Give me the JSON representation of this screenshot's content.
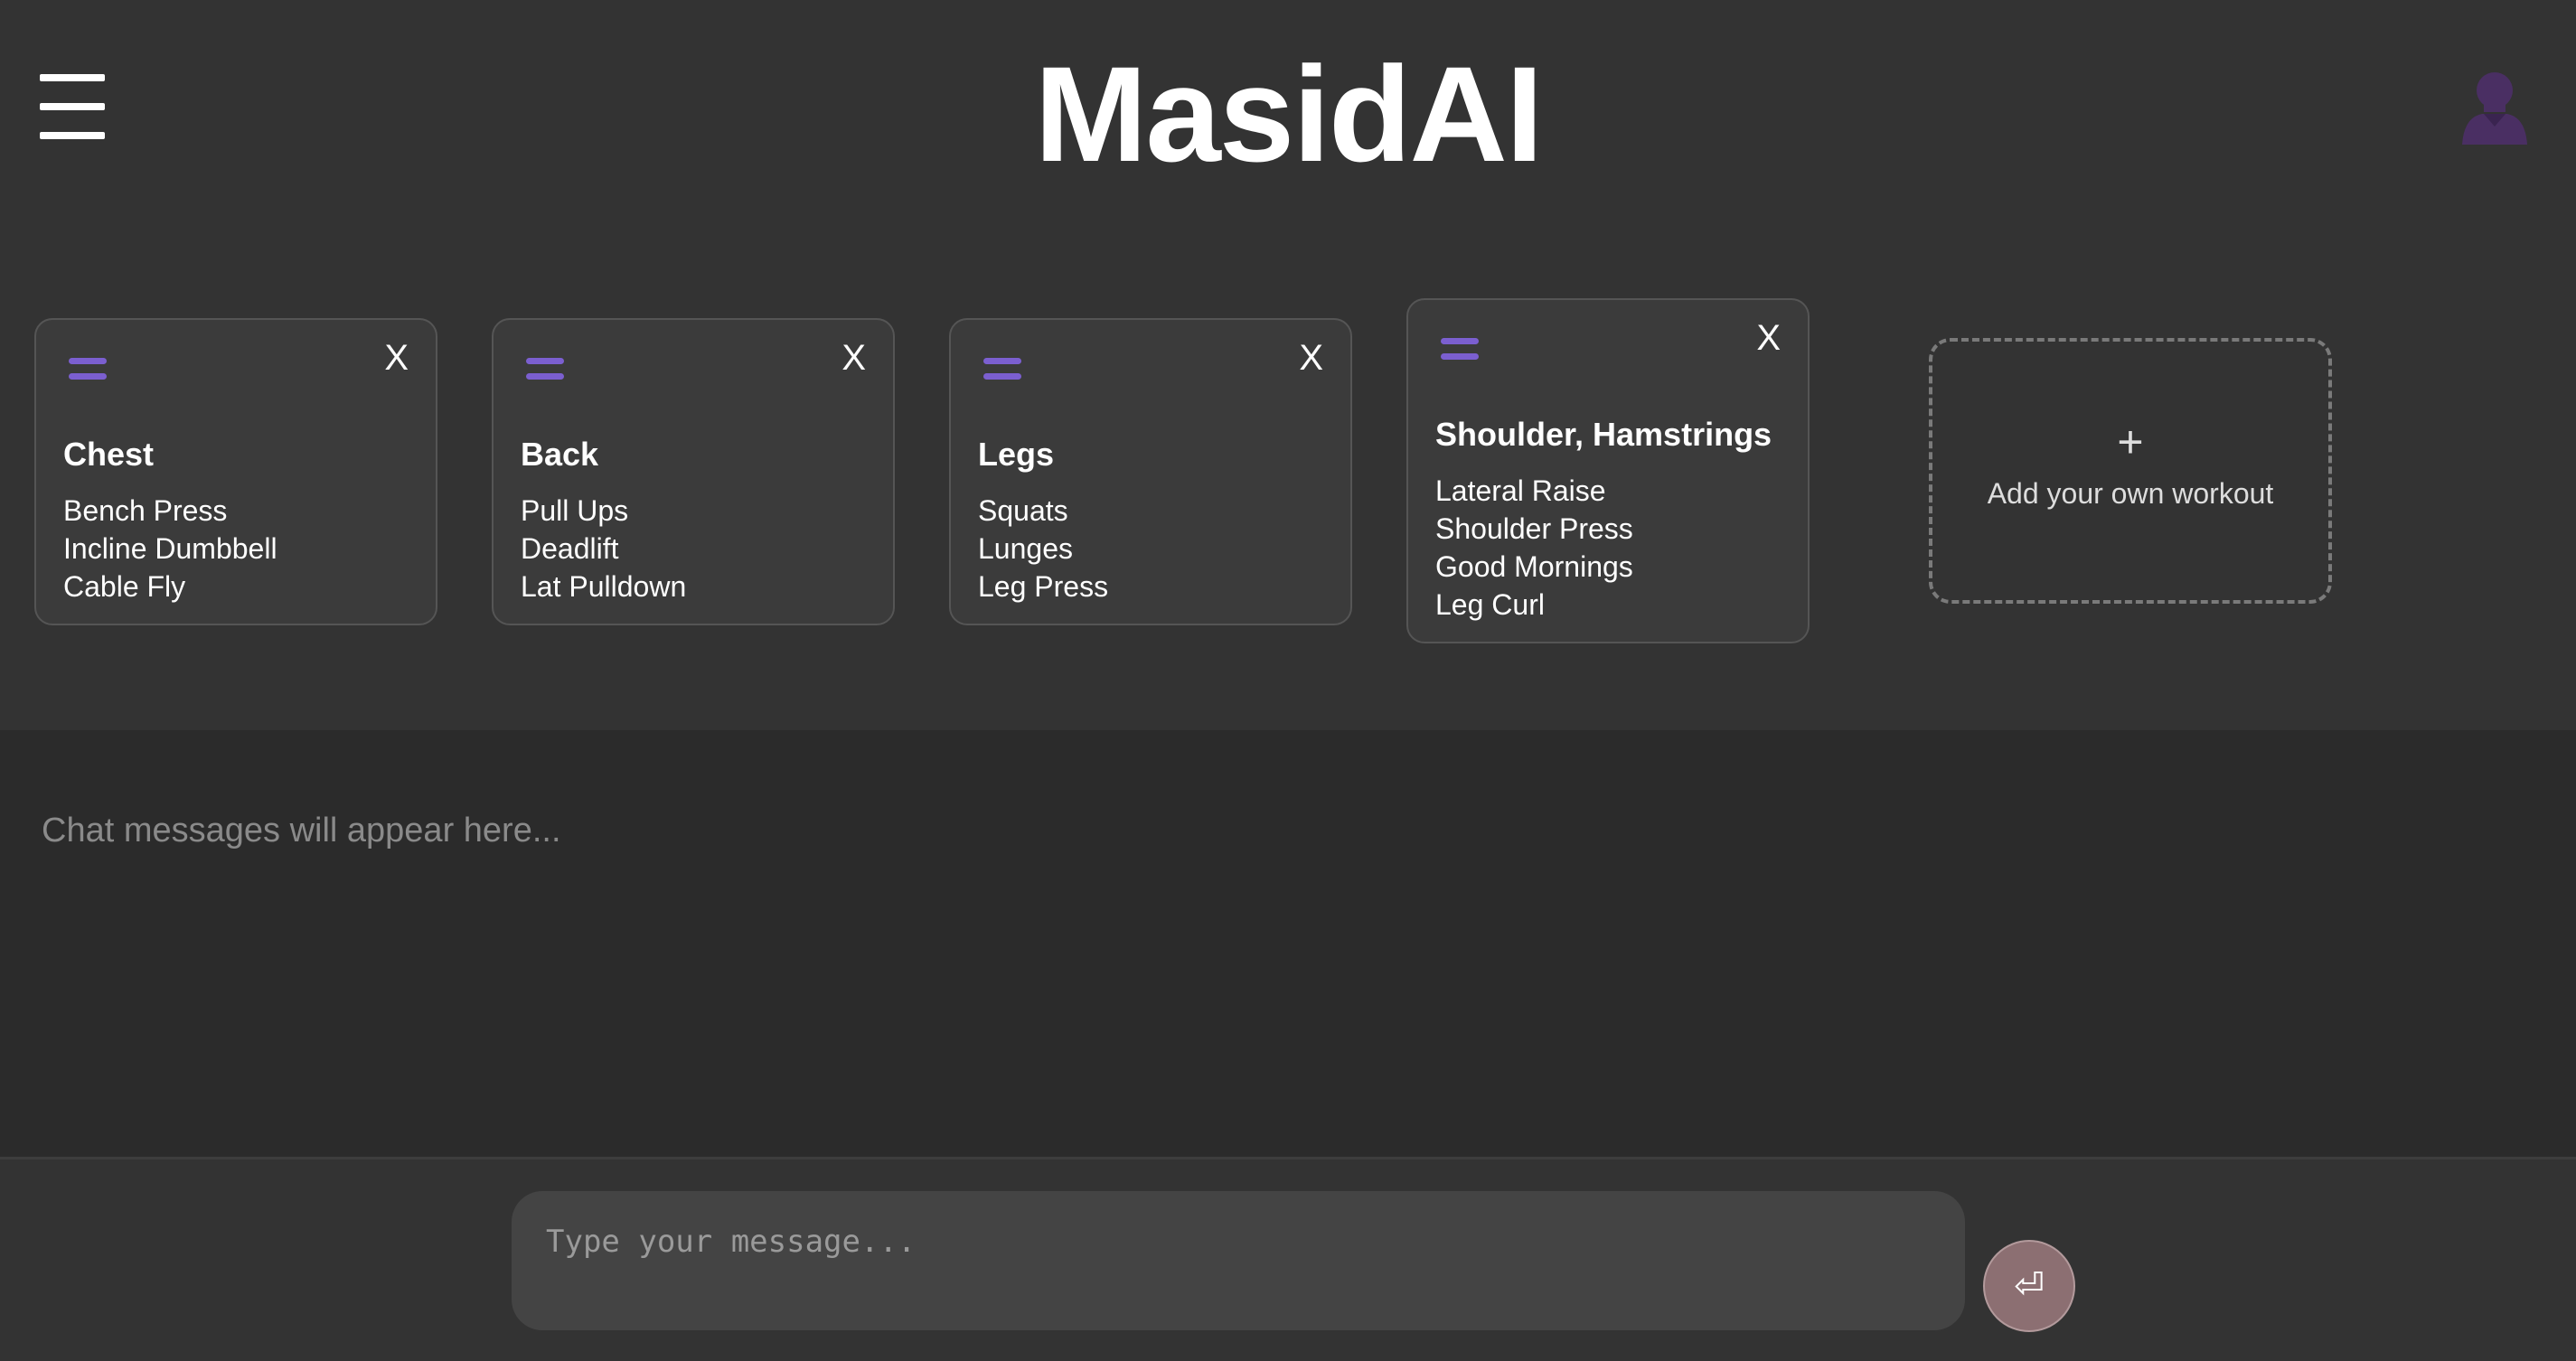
{
  "header": {
    "title": "MasidAI",
    "menu_icon": "hamburger-menu-icon",
    "avatar_icon": "user-avatar-icon",
    "accent_color": "#7b5fd0"
  },
  "workouts": [
    {
      "title": "Chest",
      "exercises": [
        "Bench Press",
        "Incline Dumbbell",
        "Cable Fly"
      ]
    },
    {
      "title": "Back",
      "exercises": [
        "Pull Ups",
        "Deadlift",
        "Lat Pulldown"
      ]
    },
    {
      "title": "Legs",
      "exercises": [
        "Squats",
        "Lunges",
        "Leg Press"
      ]
    },
    {
      "title": "Shoulder, Hamstrings",
      "exercises": [
        "Lateral Raise",
        "Shoulder Press",
        "Good Mornings",
        "Leg Curl"
      ]
    }
  ],
  "card_controls": {
    "close_label": "X",
    "drag_icon": "drag-handle-icon"
  },
  "add_workout": {
    "plus": "+",
    "label": "Add your own workout"
  },
  "chat": {
    "placeholder_text": "Chat messages will appear here..."
  },
  "composer": {
    "placeholder": "Type your message...",
    "send_symbol": "⏎",
    "send_color": "#8c6f72"
  }
}
